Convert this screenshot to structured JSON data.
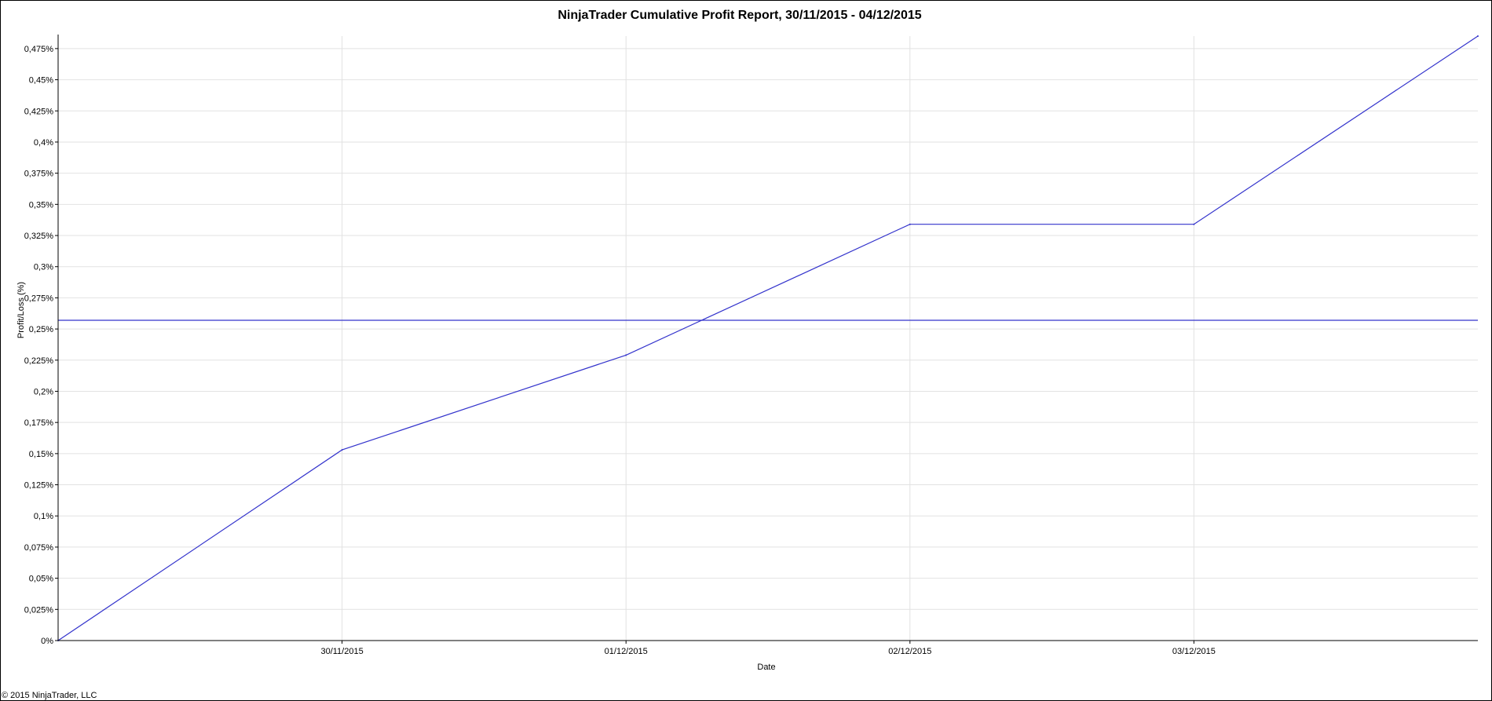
{
  "chart_data": {
    "type": "line",
    "title": "NinjaTrader Cumulative Profit Report, 30/11/2015 - 04/12/2015",
    "xlabel": "Date",
    "ylabel": "Profit/Loss (%)",
    "x_ticks": [
      "30/11/2015",
      "01/12/2015",
      "02/12/2015",
      "03/12/2015"
    ],
    "y_tick_labels": [
      "0%",
      "0,025%",
      "0,05%",
      "0,075%",
      "0,1%",
      "0,125%",
      "0,15%",
      "0,175%",
      "0,2%",
      "0,225%",
      "0,25%",
      "0,275%",
      "0,3%",
      "0,325%",
      "0,35%",
      "0,375%",
      "0,4%",
      "0,425%",
      "0,45%",
      "0,475%"
    ],
    "y_ticks": [
      0,
      0.025,
      0.05,
      0.075,
      0.1,
      0.125,
      0.15,
      0.175,
      0.2,
      0.225,
      0.25,
      0.275,
      0.3,
      0.325,
      0.35,
      0.375,
      0.4,
      0.425,
      0.45,
      0.475
    ],
    "xlim": [
      "29/11/2015",
      "04/12/2015"
    ],
    "ylim": [
      0,
      0.485
    ],
    "grid": true,
    "series": [
      {
        "x": [
          "29/11/2015",
          "30/11/2015",
          "01/12/2015",
          "02/12/2015",
          "03/12/2015",
          "04/12/2015"
        ],
        "values": [
          0,
          0.153,
          0.229,
          0.334,
          0.334,
          0.485
        ],
        "color": "#3333cc"
      }
    ],
    "reference_line": {
      "value": 0.257,
      "color": "#3333cc"
    }
  },
  "footer": {
    "copyright": "© 2015 NinjaTrader, LLC"
  }
}
